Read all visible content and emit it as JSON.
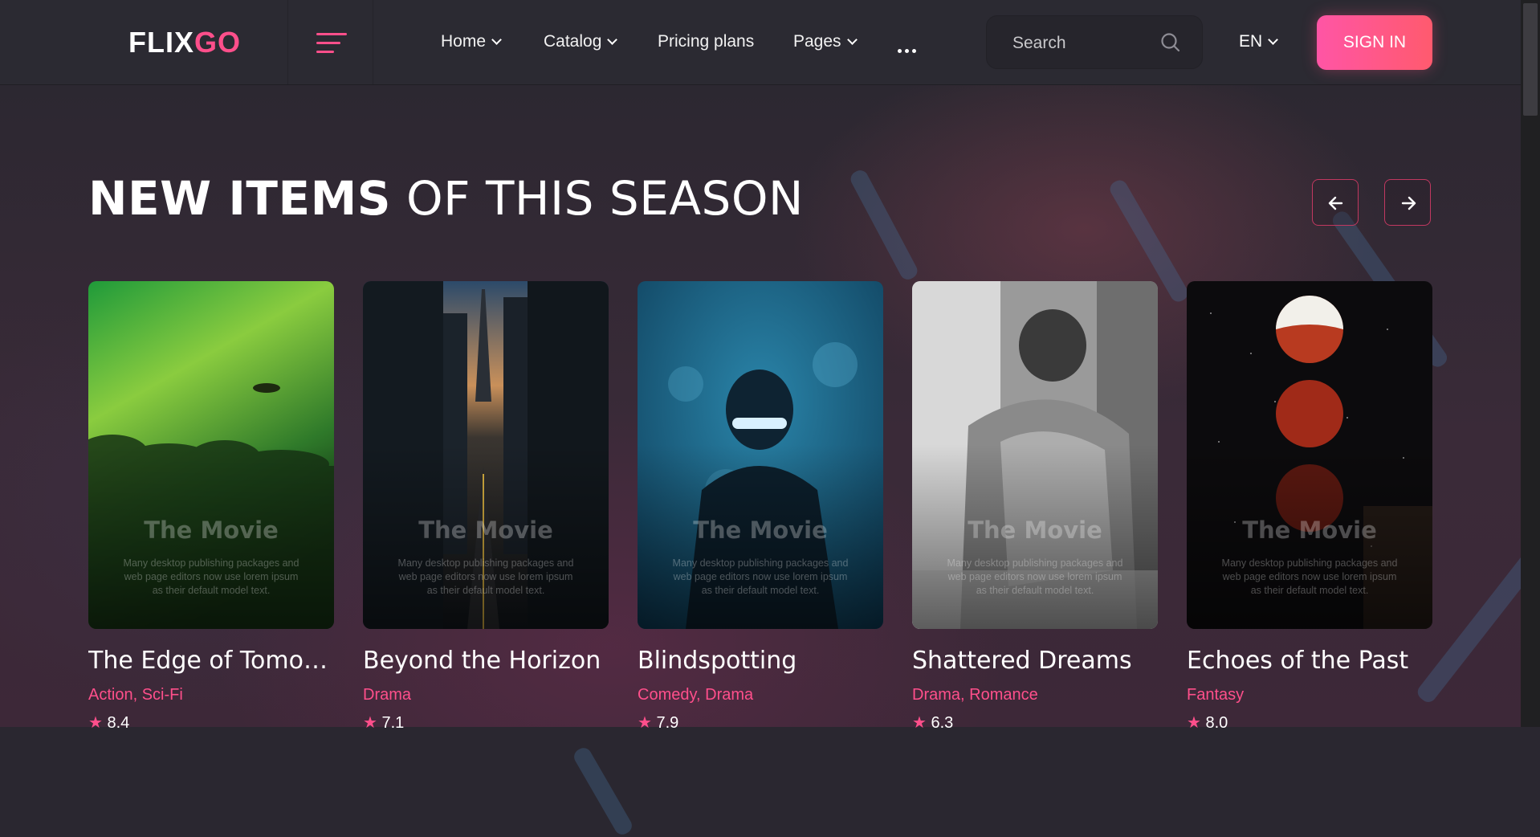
{
  "header": {
    "logo_main": "FLIX",
    "logo_accent": "GO",
    "nav": [
      {
        "label": "Home",
        "has_dropdown": true
      },
      {
        "label": "Catalog",
        "has_dropdown": true
      },
      {
        "label": "Pricing plans",
        "has_dropdown": false
      },
      {
        "label": "Pages",
        "has_dropdown": true
      }
    ],
    "search_placeholder": "Search",
    "language": "EN",
    "signin_label": "SIGN IN"
  },
  "section": {
    "title_bold": "NEW ITEMS",
    "title_light": "OF THIS SEASON"
  },
  "cards": [
    {
      "name": "The Edge of Tomorrow",
      "genres": [
        "Action",
        "Sci-Fi"
      ],
      "rating": "8.4",
      "poster_title": "The Movie",
      "poster_text": "Many desktop publishing packages and web page editors now use lorem ipsum as their default model text."
    },
    {
      "name": "Beyond the Horizon",
      "genres": [
        "Drama"
      ],
      "rating": "7.1",
      "poster_title": "The Movie",
      "poster_text": "Many desktop publishing packages and web page editors now use lorem ipsum as their default model text."
    },
    {
      "name": "Blindspotting",
      "genres": [
        "Comedy",
        "Drama"
      ],
      "rating": "7.9",
      "poster_title": "The Movie",
      "poster_text": "Many desktop publishing packages and web page editors now use lorem ipsum as their default model text."
    },
    {
      "name": "Shattered Dreams",
      "genres": [
        "Drama",
        "Romance"
      ],
      "rating": "6.3",
      "poster_title": "The Movie",
      "poster_text": "Many desktop publishing packages and web page editors now use lorem ipsum as their default model text."
    },
    {
      "name": "Echoes of the Past",
      "genres": [
        "Fantasy"
      ],
      "rating": "8.0",
      "poster_title": "The Movie",
      "poster_text": "Many desktop publishing packages and web page editors now use lorem ipsum as their default model text."
    }
  ],
  "colors": {
    "accent": "#ff4f8b",
    "background": "#2a2730",
    "header": "#2b2a32"
  }
}
